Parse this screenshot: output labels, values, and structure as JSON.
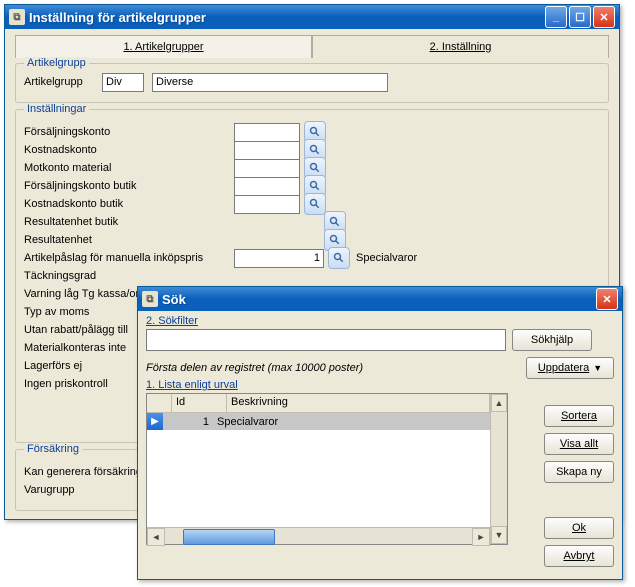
{
  "mainWindow": {
    "title": "Inställning för artikelgrupper",
    "tabs": {
      "tab1": "1. Artikelgrupper",
      "tab2": "2. Inställning"
    },
    "fs1": {
      "legend": "Artikelgrupp",
      "label": "Artikelgrupp",
      "code": "Div",
      "name": "Diverse"
    },
    "fs2": {
      "legend": "Inställningar",
      "rows": {
        "r0": "Försäljningskonto",
        "r1": "Kostnadskonto",
        "r2": "Motkonto material",
        "r3": "Försäljningskonto butik",
        "r4": "Kostnadskonto butik",
        "r5": "Resultatenhet butik",
        "r6": "Resultatenhet",
        "r7": "Artikelpåslag för manuella inköpspris",
        "r7val": "1",
        "r7text": "Specialvaror",
        "r8": "Täckningsgrad",
        "r9": "Varning låg Tg kassa/order",
        "r10": "Typ av moms",
        "r11": "Utan rabatt/pålägg till",
        "r12": "Materialkonteras inte",
        "r13": "Lagerförs ej",
        "r14": "Ingen priskontroll"
      }
    },
    "fs3": {
      "legend": "Försäkring",
      "r0": "Kan generera försäkring",
      "r1": "Varugrupp"
    }
  },
  "searchWindow": {
    "title": "Sök",
    "filterLink": "2. Sökfilter",
    "searchHelp": "Sökhjälp",
    "info": "Första delen av registret (max 10000 poster)",
    "update": "Uppdatera",
    "listLink": "1. Lista enligt urval",
    "cols": {
      "id": "Id",
      "desc": "Beskrivning"
    },
    "row": {
      "id": "1",
      "desc": "Specialvaror"
    },
    "btns": {
      "sortera": "Sortera",
      "visaallt": "Visa allt",
      "skapany": "Skapa ny",
      "ok": "Ok",
      "avbryt": "Avbryt"
    }
  }
}
